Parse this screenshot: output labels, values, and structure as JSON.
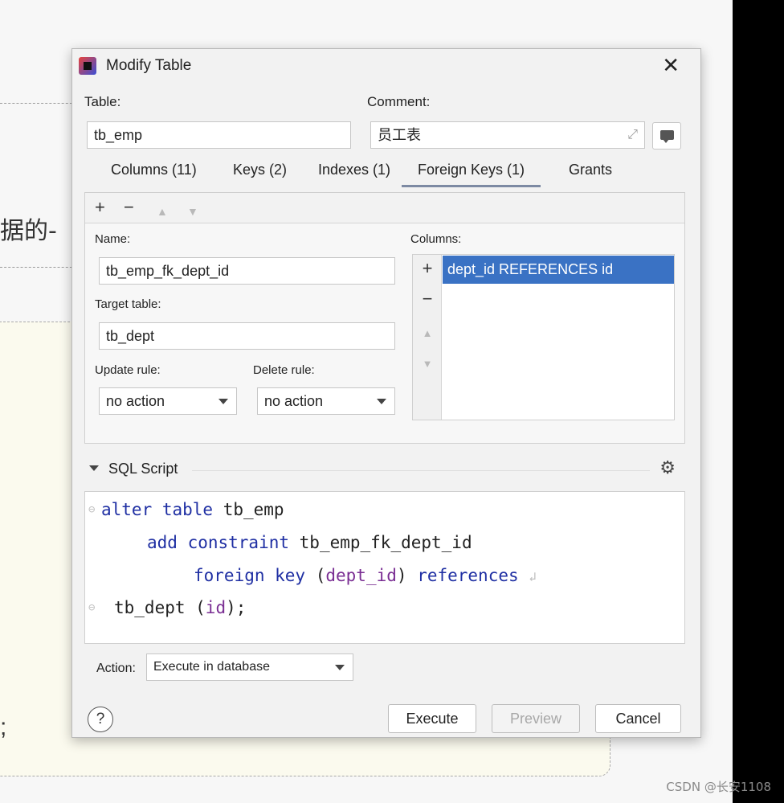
{
  "background": {
    "fragment_text": "据的-",
    "semicolon": ";",
    "watermark": "CSDN @长安1108"
  },
  "dialog": {
    "title": "Modify Table",
    "close_glyph": "✕",
    "table_label": "Table:",
    "table_value": "tb_emp",
    "comment_label": "Comment:",
    "comment_value": "员工表",
    "tabs": [
      {
        "label": "Columns (11)"
      },
      {
        "label": "Keys (2)"
      },
      {
        "label": "Indexes (1)"
      },
      {
        "label": "Foreign Keys (1)",
        "active": true
      },
      {
        "label": "Grants"
      }
    ],
    "toolbar": {
      "add": "+",
      "remove": "−",
      "up": "▲",
      "down": "▼"
    },
    "fk": {
      "name_label": "Name:",
      "name_value": "tb_emp_fk_dept_id",
      "target_label": "Target table:",
      "target_value": "tb_dept",
      "update_label": "Update rule:",
      "update_value": "no action",
      "delete_label": "Delete rule:",
      "delete_value": "no action",
      "columns_label": "Columns:",
      "columns": [
        "dept_id REFERENCES id"
      ]
    },
    "sql": {
      "title": "SQL Script",
      "lines": {
        "l1_kw": "alter table",
        "l1_rest": " tb_emp",
        "l2_kw": "add constraint",
        "l2_rest": " tb_emp_fk_dept_id",
        "l3_kw1": "foreign key",
        "l3_open": " (",
        "l3_col": "dept_id",
        "l3_close": ") ",
        "l3_kw2": "references",
        "l4_rest": "tb_dept (",
        "l4_col": "id",
        "l4_end": ");"
      }
    },
    "action_label": "Action:",
    "action_value": "Execute in database",
    "help": "?",
    "buttons": {
      "execute": "Execute",
      "preview": "Preview",
      "cancel": "Cancel"
    }
  }
}
